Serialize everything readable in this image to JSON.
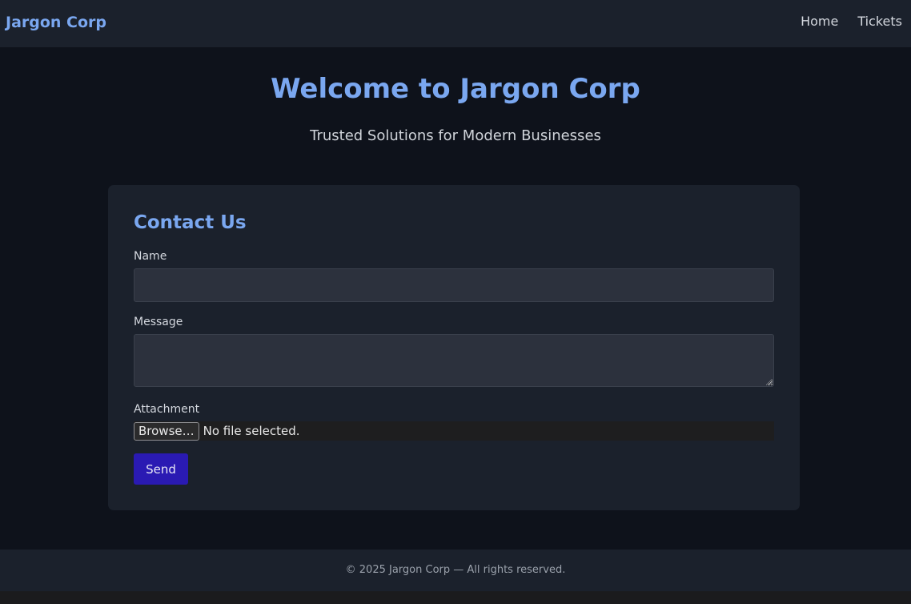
{
  "navbar": {
    "brand": "Jargon Corp",
    "links": [
      {
        "label": "Home"
      },
      {
        "label": "Tickets"
      }
    ]
  },
  "hero": {
    "title": "Welcome to Jargon Corp",
    "subtitle": "Trusted Solutions for Modern Businesses"
  },
  "contact_form": {
    "title": "Contact Us",
    "name_label": "Name",
    "name_value": "",
    "message_label": "Message",
    "message_value": "",
    "attachment_label": "Attachment",
    "browse_label": "Browse…",
    "file_status": "No file selected.",
    "send_label": "Send"
  },
  "footer": {
    "text": "© 2025 Jargon Corp — All rights reserved."
  },
  "colors": {
    "accent": "#7aa7f0",
    "send_button": "#2a1ab3",
    "page_background": "#0e121b",
    "panel_background": "#1b212c"
  }
}
